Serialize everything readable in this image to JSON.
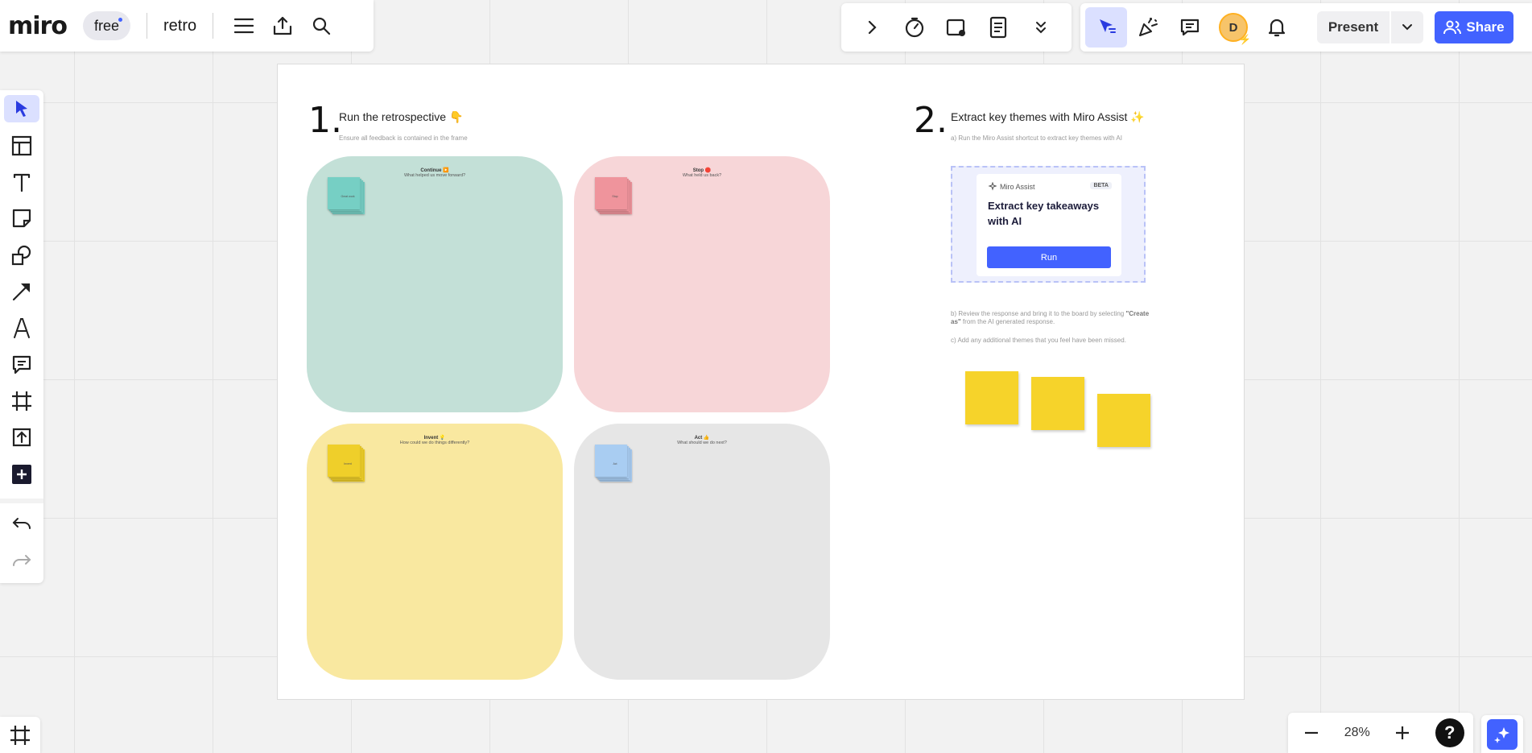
{
  "app": {
    "logo": "miro",
    "plan": "free",
    "board_name": "retro"
  },
  "toolbar_right": {
    "present_label": "Present",
    "share_label": "Share",
    "avatar_initial": "D"
  },
  "zoom": {
    "minus": "−",
    "value": "28%",
    "plus": "+",
    "help": "?"
  },
  "left_tools": [
    "select",
    "templates",
    "text",
    "sticky-note",
    "shapes",
    "connection-line",
    "pen",
    "comment",
    "frame",
    "upload",
    "more-tools"
  ],
  "board": {
    "step1": {
      "number": "1.",
      "title": "Run the retrospective 👇",
      "subtitle": "Ensure all feedback is contained in the frame"
    },
    "quadrants": [
      {
        "title": "Continue ▶️",
        "prompt": "What helped us move forward?",
        "color": "#c3e0d7",
        "sticky": "#76cfc4",
        "sticky_label": "Great work"
      },
      {
        "title": "Stop 🛑",
        "prompt": "What held us back?",
        "color": "#f7d6d8",
        "sticky": "#ef949c",
        "sticky_label": "Stop"
      },
      {
        "title": "Invent 💡",
        "prompt": "How could we do things differently?",
        "color": "#f9e8a0",
        "sticky": "#efcf2a",
        "sticky_label": "Invent"
      },
      {
        "title": "Act 👍",
        "prompt": "What should we do next?",
        "color": "#e6e6e6",
        "sticky": "#a9cdf2",
        "sticky_label": "Act"
      }
    ],
    "step2": {
      "number": "2.",
      "title": "Extract key themes with Miro Assist ✨",
      "note_a": "a) Run the Miro Assist shortcut to extract key themes with AI",
      "note_b_prefix": "b) Review the response and bring it to the board by selecting ",
      "note_b_bold": "\"Create as\"",
      "note_b_suffix": " from the AI generated response.",
      "note_c": "c) Add any additional themes that you feel have been missed."
    },
    "assist": {
      "header": "Miro Assist",
      "badge": "BETA",
      "title": "Extract key takeaways with AI",
      "button": "Run"
    }
  },
  "colors": {
    "accent": "#4262ff",
    "sticky_yellow": "#f6d32a"
  }
}
